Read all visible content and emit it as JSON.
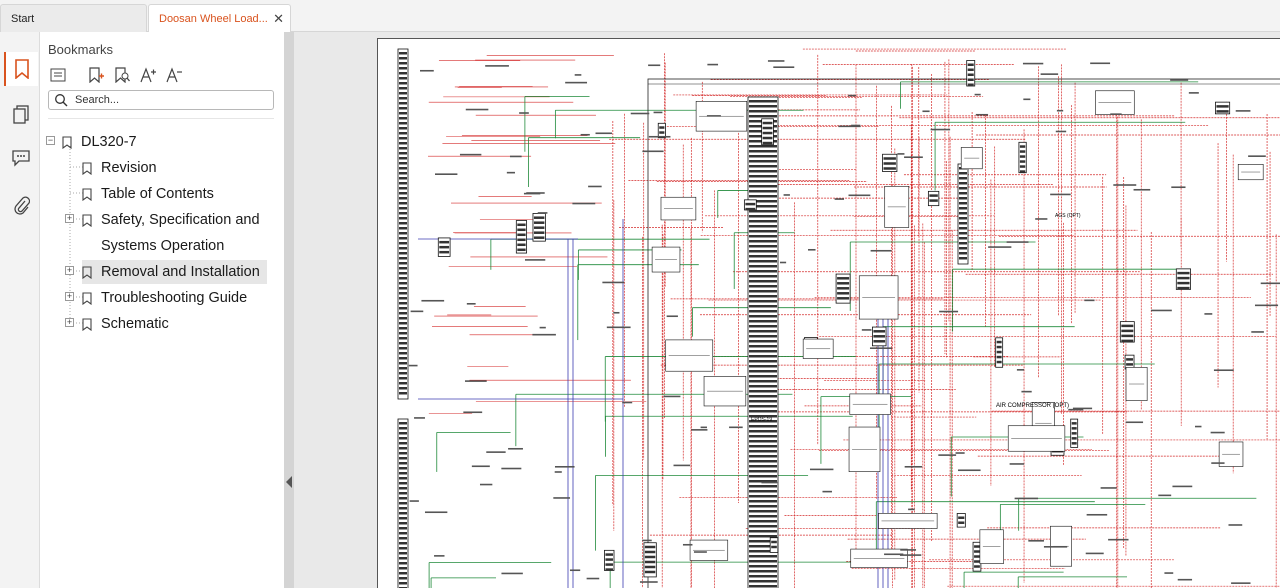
{
  "tabs": [
    {
      "label": "Start"
    },
    {
      "label": "Doosan Wheel Load..."
    }
  ],
  "sidebar": {
    "title": "Bookmarks",
    "search_placeholder": "Search...",
    "toolbar_icons": [
      "bookmark-list-icon",
      "add-bookmark-icon",
      "find-bookmark-icon",
      "increase-font-icon",
      "decrease-font-icon"
    ],
    "rail_icons": [
      "bookmark-icon",
      "pages-icon",
      "comments-icon",
      "attachments-icon"
    ],
    "tree": {
      "root": "DL320-7",
      "items": [
        {
          "label": "Revision",
          "expandable": false
        },
        {
          "label": "Table of Contents",
          "expandable": false
        },
        {
          "label": "Safety, Specification and",
          "label2": "Systems Operation",
          "expandable": true
        },
        {
          "label": "Removal and Installation",
          "expandable": true,
          "selected": true
        },
        {
          "label": "Troubleshooting Guide",
          "expandable": true
        },
        {
          "label": "Schematic",
          "expandable": true
        }
      ]
    }
  },
  "document": {
    "schematic_labels": [
      "EPOS-19",
      "AIR COMPRESSOR (OPT)",
      "AGS (OPT)"
    ]
  },
  "colors": {
    "accent": "#d9531e",
    "wire_red": "#d42a2a",
    "wire_green": "#1f8a3a",
    "wire_blue": "#3b3bb0"
  }
}
